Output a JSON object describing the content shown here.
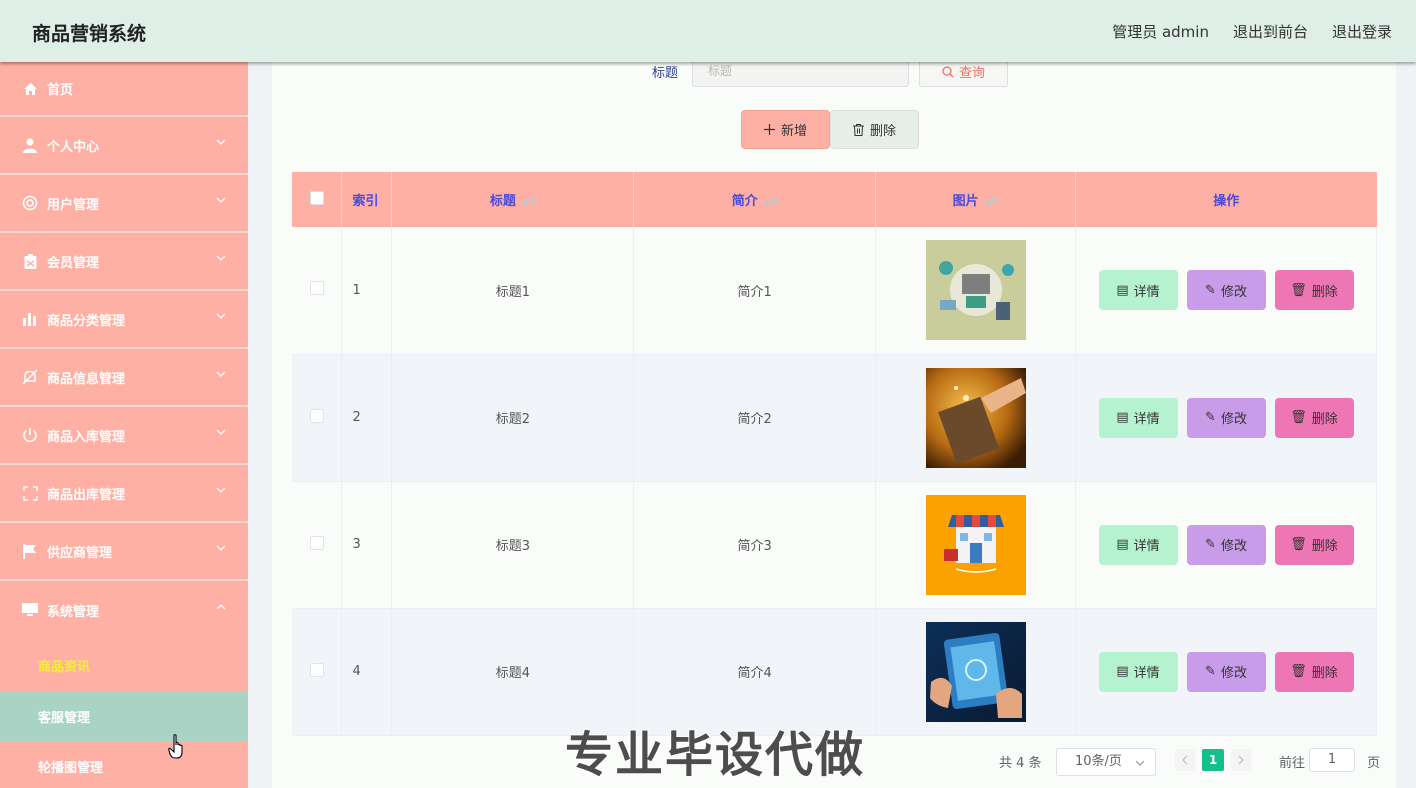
{
  "header": {
    "title": "商品营销系统",
    "user": "管理员 admin",
    "front": "退出到前台",
    "logout": "退出登录"
  },
  "sidebar": {
    "items": [
      {
        "label": "首页",
        "icon": "home-icon"
      },
      {
        "label": "个人中心",
        "icon": "user-icon"
      },
      {
        "label": "用户管理",
        "icon": "help-ring-icon"
      },
      {
        "label": "会员管理",
        "icon": "clipboard-icon"
      },
      {
        "label": "商品分类管理",
        "icon": "bar-chart-icon"
      },
      {
        "label": "商品信息管理",
        "icon": "mute-bell-icon"
      },
      {
        "label": "商品入库管理",
        "icon": "power-icon"
      },
      {
        "label": "商品出库管理",
        "icon": "fullscreen-icon"
      },
      {
        "label": "供应商管理",
        "icon": "flag-icon"
      },
      {
        "label": "系统管理",
        "icon": "monitor-icon"
      }
    ],
    "sub_items": [
      "商品资讯",
      "客服管理",
      "轮播图管理"
    ]
  },
  "search": {
    "label": "标题",
    "placeholder": "标题",
    "button": "查询"
  },
  "actions": {
    "add": "新增",
    "delete": "删除"
  },
  "table": {
    "headers": [
      "索引",
      "标题",
      "简介",
      "图片",
      "操作"
    ],
    "rows": [
      {
        "index": "1",
        "title": "标题1",
        "intro": "简介1"
      },
      {
        "index": "2",
        "title": "标题2",
        "intro": "简介2"
      },
      {
        "index": "3",
        "title": "标题3",
        "intro": "简介3"
      },
      {
        "index": "4",
        "title": "标题4",
        "intro": "简介4"
      }
    ],
    "op_labels": {
      "detail": "详情",
      "edit": "修改",
      "delete": "删除"
    }
  },
  "pagination": {
    "total": "共 4 条",
    "page_size": "10条/页",
    "current": "1",
    "goto_label": "前往",
    "goto_value": "1",
    "goto_suffix": "页"
  },
  "watermark": "专业毕设代做",
  "colors": {
    "sidebar": "#ffb0a4",
    "header": "#dfeee6",
    "table_header": "#ffb0a4",
    "detail_btn": "#b5f2d0",
    "edit_btn": "#c89ce9",
    "delete_btn": "#ef76b4",
    "pager_active": "#13c08b"
  }
}
